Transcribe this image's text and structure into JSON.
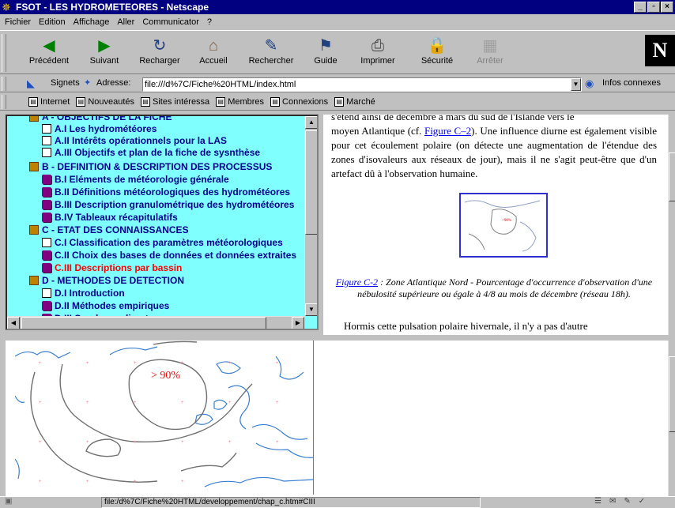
{
  "window": {
    "title": "FSOT - LES HYDROMETEORES - Netscape"
  },
  "menu": [
    "Fichier",
    "Edition",
    "Affichage",
    "Aller",
    "Communicator",
    "?"
  ],
  "toolbar": {
    "back": "Précédent",
    "forward": "Suivant",
    "reload": "Recharger",
    "home": "Accueil",
    "search": "Rechercher",
    "guide": "Guide",
    "print": "Imprimer",
    "security": "Sécurité",
    "stop": "Arrêter",
    "logo": "N"
  },
  "location": {
    "bookmarks": "Signets",
    "address_label": "Adresse:",
    "url": "file:///d%7C/Fiche%20HTML/index.html",
    "related": "Infos connexes"
  },
  "personal_bar": [
    "Internet",
    "Nouveautés",
    "Sites intéressa",
    "Membres",
    "Connexions",
    "Marché"
  ],
  "toc": [
    {
      "label": "A - OBJECTIFS DE LA FICHE",
      "kind": "section"
    },
    {
      "label": "A.I Les hydrométéores",
      "kind": "page"
    },
    {
      "label": "A.II Intérêts opérationnels pour la LAS",
      "kind": "page"
    },
    {
      "label": "A.III Objectifs et plan de la fiche de sysnthèse",
      "kind": "page"
    },
    {
      "label": "B - DEFINITION & DESCRIPTION DES PROCESSUS",
      "kind": "section"
    },
    {
      "label": "B.I Eléments de météorologie générale",
      "kind": "book"
    },
    {
      "label": "B.II Définitions météorologiques des hydrométéores",
      "kind": "book"
    },
    {
      "label": "B.III Description granulométrique des hydrométéores",
      "kind": "book"
    },
    {
      "label": "B.IV Tableaux récapitulatifs",
      "kind": "book"
    },
    {
      "label": "C - ETAT DES CONNAISSANCES",
      "kind": "section"
    },
    {
      "label": "C.I Classification des paramètres météorologiques",
      "kind": "page"
    },
    {
      "label": "C.II Choix des bases de données et données extraites",
      "kind": "book"
    },
    {
      "label": "C.III Descriptions par bassin",
      "kind": "book",
      "active": true
    },
    {
      "label": "D - METHODES DE DETECTION",
      "kind": "section"
    },
    {
      "label": "D.I Introduction",
      "kind": "page"
    },
    {
      "label": "D.II Méthodes empiriques",
      "kind": "book"
    },
    {
      "label": "D.III Sondages directs",
      "kind": "book"
    }
  ],
  "content": {
    "line0": "s'étend ainsi de décembre à mars du sud de l'Islande vers le",
    "para1_pre": "moyen Atlantique (cf. ",
    "para1_link": "Figure C–2",
    "para1_post": "). Une influence diurne est également visible pour cet écoulement polaire (on détecte une augmentation de l'étendue des zones d'isovaleurs aux réseaux de jour), mais il ne s'agit peut-être que d'un artefact dû à l'observation humaine.",
    "caption_link": "Figure C-2",
    "caption_text": " : Zone Atlantique Nord - Pourcentage d'occurrence d'observation d'une nébulosité supérieure ou égale à 4/8 au mois de décembre (réseau 18h).",
    "para2": "Hormis cette pulsation polaire hivernale, il n'y a pas d'autre"
  },
  "map": {
    "label": "> 90%"
  },
  "status": {
    "url": "file:/d%7C/Fiche%20HTML/developpement/chap_c.htm#CIII"
  },
  "colors": {
    "titlebar": "#000080",
    "toc_bg": "#80ffff",
    "active": "#ff0000"
  }
}
